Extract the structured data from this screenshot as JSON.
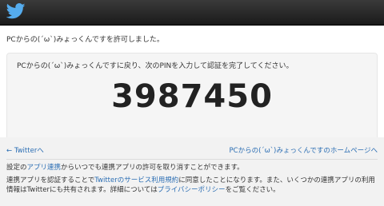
{
  "header": {
    "logo_icon": "twitter-bird-icon",
    "color": "#55acee"
  },
  "main": {
    "authorized_message": "PCからの(´ω`)みょっくんですを許可しました。",
    "pin_instruction": "PCからの(´ω`)みょっくんですに戻り、次のPINを入力して認証を完了してください。",
    "pin": "3987450"
  },
  "footer": {
    "back_link": "← Twitterへ",
    "home_link": "PCからの(´ω`)みょっくんですのホームページへ",
    "revoke_pre": "設定の",
    "revoke_link": "アプリ連携",
    "revoke_post": "からいつでも連携アプリの許可を取り消すことができます。",
    "policy_pre": "連携アプリを認証することで",
    "policy_tos_link": "Twitterのサービス利用規約",
    "policy_mid": "に同意したことになります。また、いくつかの連携アプリの利用情報はTwitterにも共有されます。詳細については",
    "policy_privacy_link": "プライバシーポリシー",
    "policy_post": "をご覧ください。"
  }
}
